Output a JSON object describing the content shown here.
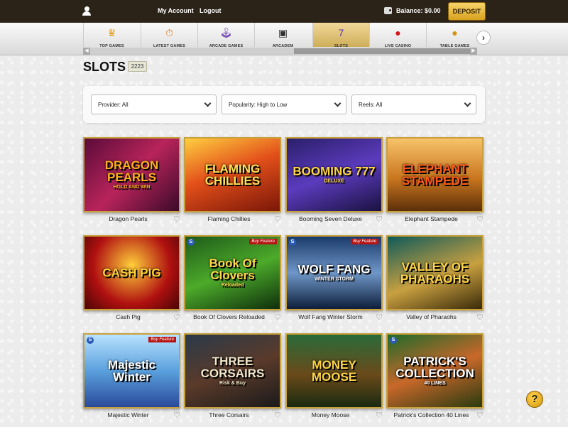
{
  "topbar": {
    "my_account": "My Account",
    "logout": "Logout",
    "balance": "Balance: $0.00",
    "deposit": "DEPOSIT"
  },
  "categories": [
    {
      "label": "TOP GAMES",
      "icon": "crown-icon",
      "glyph": "♛",
      "color": "#e39a16"
    },
    {
      "label": "LATEST GAMES",
      "icon": "stopwatch-icon",
      "glyph": "⏱",
      "color": "#e07a10"
    },
    {
      "label": "ARCADE GAMES",
      "icon": "joystick-icon",
      "glyph": "🕹",
      "color": "#7a4fb3"
    },
    {
      "label": "ARCADEM",
      "icon": "slot-machine-icon",
      "glyph": "▣",
      "color": "#333"
    },
    {
      "label": "SLOTS",
      "icon": "slots-777-icon",
      "glyph": "7",
      "color": "#5b2fb0"
    },
    {
      "label": "LIVE CASINO",
      "icon": "poker-chip-icon",
      "glyph": "●",
      "color": "#d21a1a"
    },
    {
      "label": "TABLE GAMES",
      "icon": "coin-icon",
      "glyph": "●",
      "color": "#d4920f"
    }
  ],
  "page": {
    "title": "SLOTS",
    "count": "2223"
  },
  "filters": {
    "provider": "Provider: All",
    "popularity": "Popularity: High to Low",
    "reels": "Reels: All"
  },
  "games": [
    {
      "name": "Dragon Pearls",
      "art": "DRAGON PEARLS",
      "sub": "HOLD AND WIN",
      "bg": "linear-gradient(135deg,#5a0b3a,#b8245a 50%,#3a0a2a)",
      "fg": "#ffb020",
      "badge": "",
      "s": false
    },
    {
      "name": "Flaming Chillies",
      "art": "FLAMING CHILLIES",
      "sub": "",
      "bg": "linear-gradient(160deg,#ffcf40,#e3501a 45%,#7a1608)",
      "fg": "#ffe25a",
      "badge": "",
      "s": false
    },
    {
      "name": "Booming Seven Deluxe",
      "art": "BOOMING 777",
      "sub": "DELUXE",
      "bg": "linear-gradient(160deg,#2a1f6a,#5b3bbd 50%,#1a1240)",
      "fg": "#ffd54a",
      "badge": "",
      "s": false
    },
    {
      "name": "Elephant Stampede",
      "art": "ELEPHANT STAMPEDE",
      "sub": "",
      "bg": "linear-gradient(180deg,#f7c36a,#c9761e 55%,#5c2f0a)",
      "fg": "#ff5a1a",
      "badge": "",
      "s": false
    },
    {
      "name": "Cash Pig",
      "art": "CASH PIG",
      "sub": "",
      "bg": "radial-gradient(circle at 50% 40%,#ffcf3a,#b01010 60%,#4a0505)",
      "fg": "#ffd23a",
      "badge": "",
      "s": false
    },
    {
      "name": "Book Of Clovers Reloaded",
      "art": "Book Of Clovers",
      "sub": "Reloaded",
      "bg": "linear-gradient(160deg,#1e5a1a,#4caa2a 50%,#0e2e0c)",
      "fg": "#ffd54a",
      "badge": "Buy Feature",
      "s": true
    },
    {
      "name": "Wolf Fang Winter Storm",
      "art": "WOLF FANG",
      "sub": "WINTER STORM",
      "bg": "linear-gradient(180deg,#1a3a6a,#6f97c8 50%,#0d1e3a)",
      "fg": "#ffffff",
      "badge": "Buy Feature",
      "s": true
    },
    {
      "name": "Valley of Pharaohs",
      "art": "VALLEY OF PHARAOHS",
      "sub": "",
      "bg": "linear-gradient(160deg,#0f5a5a,#c8a040 55%,#3a2a0a)",
      "fg": "#ffd54a",
      "badge": "",
      "s": false
    },
    {
      "name": "Majestic Winter",
      "art": "Majestic Winter",
      "sub": "",
      "bg": "linear-gradient(180deg,#b9e2ff,#5aa0dd 50%,#2a4a9a)",
      "fg": "#ffffff",
      "badge": "Buy Feature",
      "s": true
    },
    {
      "name": "Three Corsairs",
      "art": "THREE CORSAIRS",
      "sub": "Risk & Buy",
      "bg": "linear-gradient(160deg,#2a3a4a,#5a3a2a 50%,#1a1a1a)",
      "fg": "#f2e6c8",
      "badge": "",
      "s": false
    },
    {
      "name": "Money Moose",
      "art": "MONEY MOOSE",
      "sub": "",
      "bg": "linear-gradient(180deg,#2a6a3a,#6a4a1a 55%,#1a2a10)",
      "fg": "#ffd54a",
      "badge": "",
      "s": false
    },
    {
      "name": "Patrick's Collection 40 Lines",
      "art": "PATRICK'S COLLECTION",
      "sub": "40 LINES",
      "bg": "linear-gradient(160deg,#1e6a2a,#c8682a 50%,#2a3a10)",
      "fg": "#ffffff",
      "badge": "",
      "s": true
    }
  ],
  "help": "?"
}
